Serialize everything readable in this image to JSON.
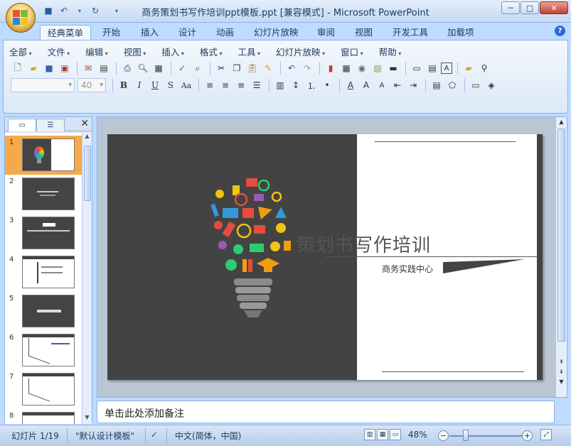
{
  "window": {
    "title": "商务策划书写作培训ppt模板.ppt [兼容模式] - Microsoft PowerPoint"
  },
  "ribbon": {
    "tabs": [
      "经典菜单",
      "开始",
      "插入",
      "设计",
      "动画",
      "幻灯片放映",
      "审阅",
      "视图",
      "开发工具",
      "加载项"
    ],
    "active_tab": "经典菜单",
    "menus": [
      "全部",
      "文件",
      "编辑",
      "视图",
      "插入",
      "格式",
      "工具",
      "幻灯片放映",
      "窗口",
      "帮助"
    ],
    "font_size": "40"
  },
  "slides_pane": {
    "numbers": [
      "1",
      "2",
      "3",
      "4",
      "5",
      "6",
      "7",
      "8"
    ],
    "selected": 1
  },
  "slide": {
    "title": "策划书写作培训",
    "subtitle": "商务实践中心"
  },
  "notes": {
    "placeholder": "单击此处添加备注"
  },
  "status": {
    "slide_count": "幻灯片 1/19",
    "theme": "\"默认设计模板\"",
    "language": "中文(简体，中国)",
    "zoom": "48%"
  },
  "colors": {
    "slide_dark": "#434343",
    "selection": "#f6a94a",
    "ribbon_border": "#8db2e3"
  }
}
